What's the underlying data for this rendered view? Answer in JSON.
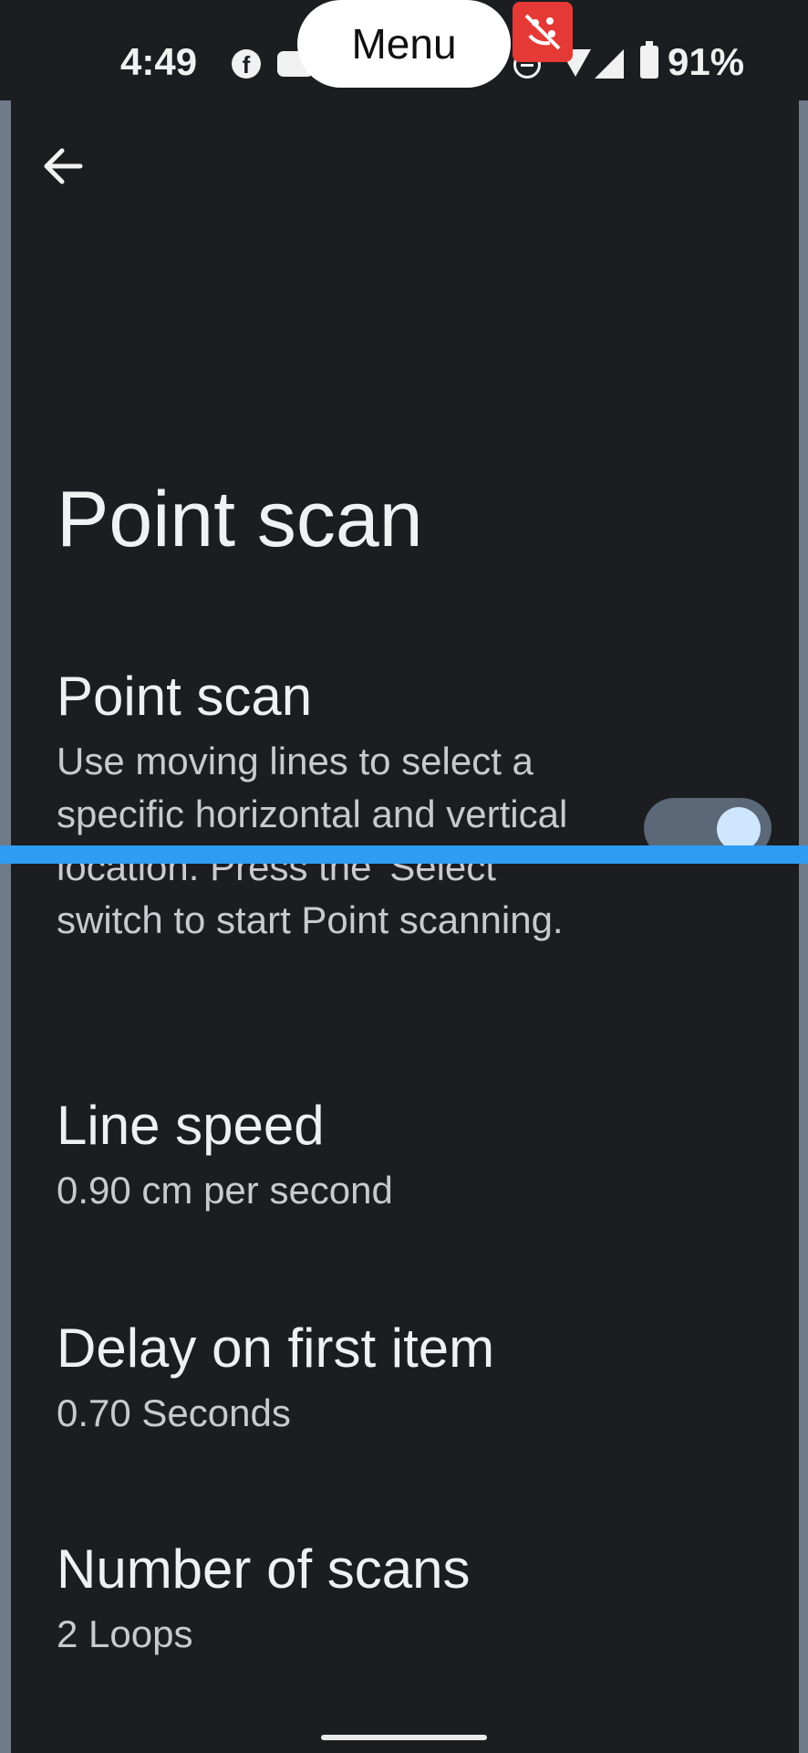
{
  "status_bar": {
    "time": "4:49",
    "battery": "91%",
    "menu_label": "Menu"
  },
  "page": {
    "title": "Point scan"
  },
  "preferences": {
    "point_scan": {
      "title": "Point scan",
      "summary": "Use moving lines to select a specific horizontal and vertical location. Press the 'Select' switch to start Point scanning.",
      "enabled": true
    },
    "line_speed": {
      "title": "Line speed",
      "summary": "0.90 cm per second"
    },
    "delay_first_item": {
      "title": "Delay on first item",
      "summary": "0.70 Seconds"
    },
    "number_of_scans": {
      "title": "Number of scans",
      "summary": "2 Loops"
    }
  },
  "colors": {
    "background": "#1b1d20",
    "scan_line": "#2f9cf4",
    "toggle_track": "#5a6878",
    "toggle_thumb": "#cfe6ff",
    "badge": "#e53935"
  }
}
